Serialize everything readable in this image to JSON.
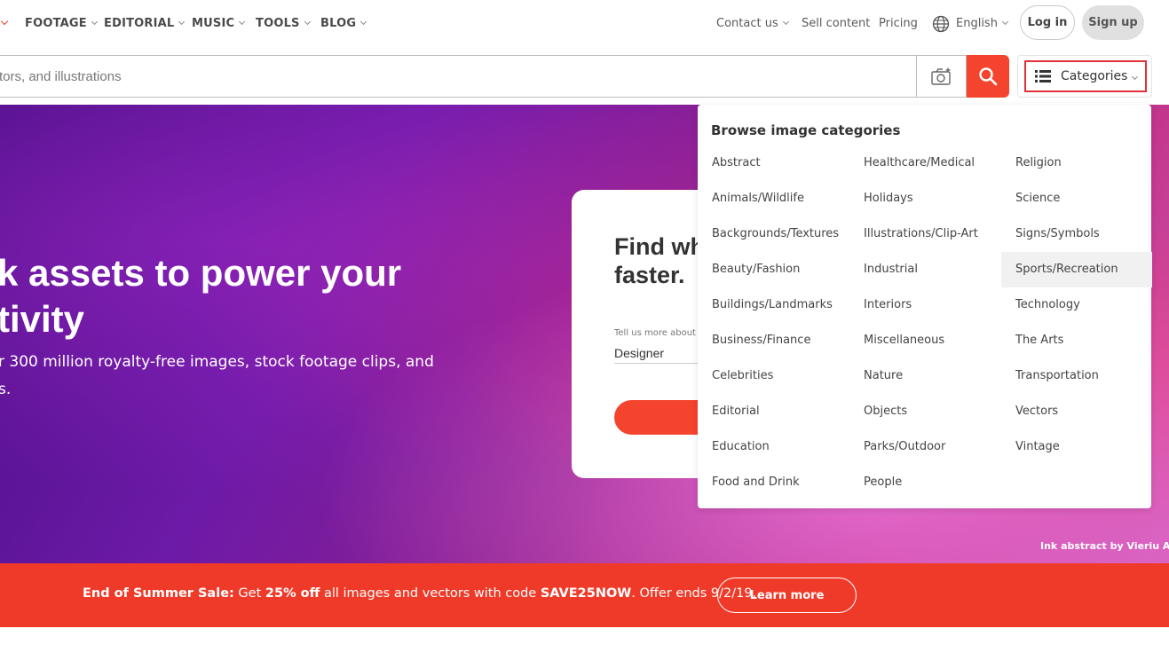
{
  "nav": {
    "left_items": [
      "FOOTAGE",
      "EDITORIAL",
      "MUSIC",
      "TOOLS",
      "BLOG"
    ],
    "contact": "Contact us",
    "sell": "Sell content",
    "pricing": "Pricing",
    "language": "English",
    "login": "Log in",
    "signup": "Sign up"
  },
  "search": {
    "placeholder": "tors, and illustrations",
    "categories_label": "Categories"
  },
  "hero": {
    "title_line1": "k assets to power your",
    "title_line2": "tivity",
    "sub_line1": "r 300 million royalty-free images, stock footage clips, and",
    "sub_line2": "s.",
    "credit": "Ink abstract by Vieriu Adrian"
  },
  "find_card": {
    "title_line1": "Find wh",
    "title_line2": "faster.",
    "label": "Tell us more about",
    "value": "Designer"
  },
  "categories": {
    "title": "Browse image categories",
    "col1": [
      "Abstract",
      "Animals/Wildlife",
      "Backgrounds/Textures",
      "Beauty/Fashion",
      "Buildings/Landmarks",
      "Business/Finance",
      "Celebrities",
      "Editorial",
      "Education",
      "Food and Drink"
    ],
    "col2": [
      "Healthcare/Medical",
      "Holidays",
      "Illustrations/Clip-Art",
      "Industrial",
      "Interiors",
      "Miscellaneous",
      "Nature",
      "Objects",
      "Parks/Outdoor",
      "People"
    ],
    "col3": [
      "Religion",
      "Science",
      "Signs/Symbols",
      "Sports/Recreation",
      "Technology",
      "The Arts",
      "Transportation",
      "Vectors",
      "Vintage"
    ]
  },
  "promo": {
    "lead": "End of Summer Sale:",
    "t1": " Get ",
    "discount": "25% off",
    "t2": " all images and vectors with code ",
    "code": "SAVE25NOW",
    "t3": ". Offer ends 9/2/19.",
    "button": "Learn more"
  },
  "colors": {
    "accent": "#f4442e",
    "highlight_border": "#e0313b"
  }
}
